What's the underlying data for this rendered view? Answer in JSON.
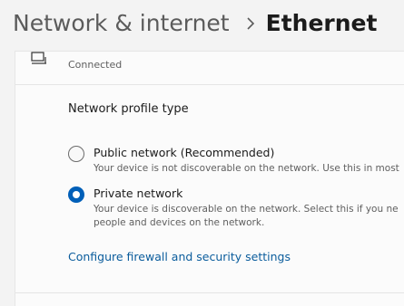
{
  "breadcrumb": {
    "parent": "Network & internet",
    "current": "Ethernet"
  },
  "connection": {
    "icon": "ethernet-icon",
    "status": "Connected"
  },
  "profile": {
    "label": "Network profile type",
    "options": [
      {
        "title": "Public network (Recommended)",
        "description_lines": [
          "Your device is not discoverable on the network. Use this in most"
        ],
        "selected": false
      },
      {
        "title": "Private network",
        "description_lines": [
          "Your device is discoverable on the network. Select this if you ne",
          "people and devices on the network."
        ],
        "selected": true
      }
    ]
  },
  "firewall_link": "Configure firewall and security settings",
  "colors": {
    "accent": "#005fb8",
    "link": "#0a5c9c",
    "background": "#f3f3f3",
    "card": "#fbfbfb"
  }
}
